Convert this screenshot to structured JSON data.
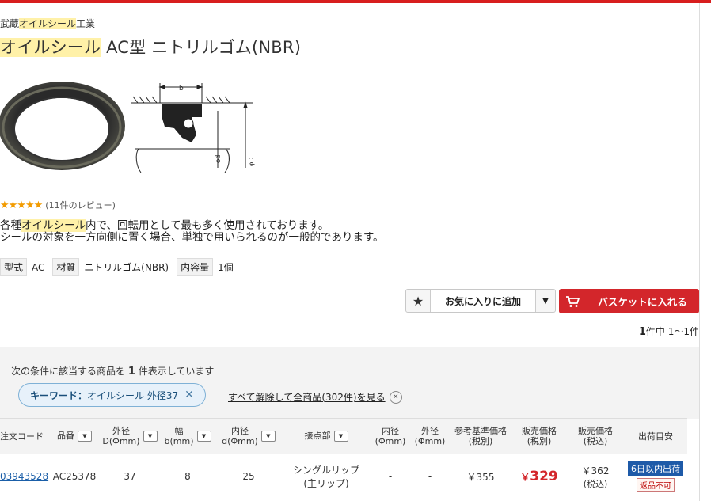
{
  "breadcrumb": {
    "prefix": "武蔵",
    "highlight": "オイルシール",
    "suffix": "工業"
  },
  "title": {
    "highlight": "オイルシール",
    "rest": " AC型 ニトリルゴム(NBR)"
  },
  "drawing": {
    "label_b": "b",
    "label_d": "φd",
    "label_D": "φD"
  },
  "rating": {
    "stars": "★★★★★",
    "text": "(11件のレビュー)",
    "value": 4.5
  },
  "description": {
    "line1_prefix": "各種",
    "line1_highlight": "オイルシール",
    "line1_suffix": "内で、回転用として最も多く使用されております。",
    "line2": "シールの対象を一方向側に置く場合、単独で用いられるのが一般的であります。"
  },
  "specs": [
    {
      "key": "型式",
      "value": "AC"
    },
    {
      "key": "材質",
      "value": "ニトリルゴム(NBR)"
    },
    {
      "key": "内容量",
      "value": "1個"
    }
  ],
  "favorite": {
    "label": "お気に入りに追加",
    "icon": "star-icon"
  },
  "cart": {
    "label": "バスケットに入れる",
    "icon": "cart-icon",
    "color": "#d3262b"
  },
  "count": {
    "num": "1",
    "text": "件中 1〜1件"
  },
  "conditions": {
    "text_pre": "次の条件に該当する商品を",
    "num": "1",
    "text_post": "件表示しています",
    "chip_key": "キーワード：",
    "chip_value": "オイルシール 外径37",
    "clear_all": "すべて解除して全商品(302件)を見る"
  },
  "table": {
    "headers": {
      "code": "注文コード",
      "part": "品番",
      "outer1": "外径",
      "outer2": "D(Φmm)",
      "width1": "幅",
      "width2": "b(mm)",
      "inner1": "内径",
      "inner2": "d(Φmm)",
      "contact": "接点部",
      "inner_b1": "内径",
      "inner_b2": "(Φmm)",
      "outer_b1": "外径",
      "outer_b2": "(Φmm)",
      "ref1": "参考基準価格",
      "ref2": "(税別)",
      "sale1": "販売価格",
      "sale2": "(税別)",
      "salet1": "販売価格",
      "salet2": "(税込)",
      "ship": "出荷目安"
    },
    "row": {
      "code": "03943528",
      "part": "AC25378",
      "outer": "37",
      "width": "8",
      "inner": "25",
      "contact1": "シングルリップ",
      "contact2": "(主リップ)",
      "inner_b": "-",
      "outer_b": "-",
      "ref_price": "￥355",
      "sale_yen": "￥",
      "sale_price": "329",
      "sale_tax_price": "￥362",
      "sale_tax_note": "(税込)",
      "ship_badge": "6日以内出荷",
      "nonreturn": "返品不可"
    }
  }
}
